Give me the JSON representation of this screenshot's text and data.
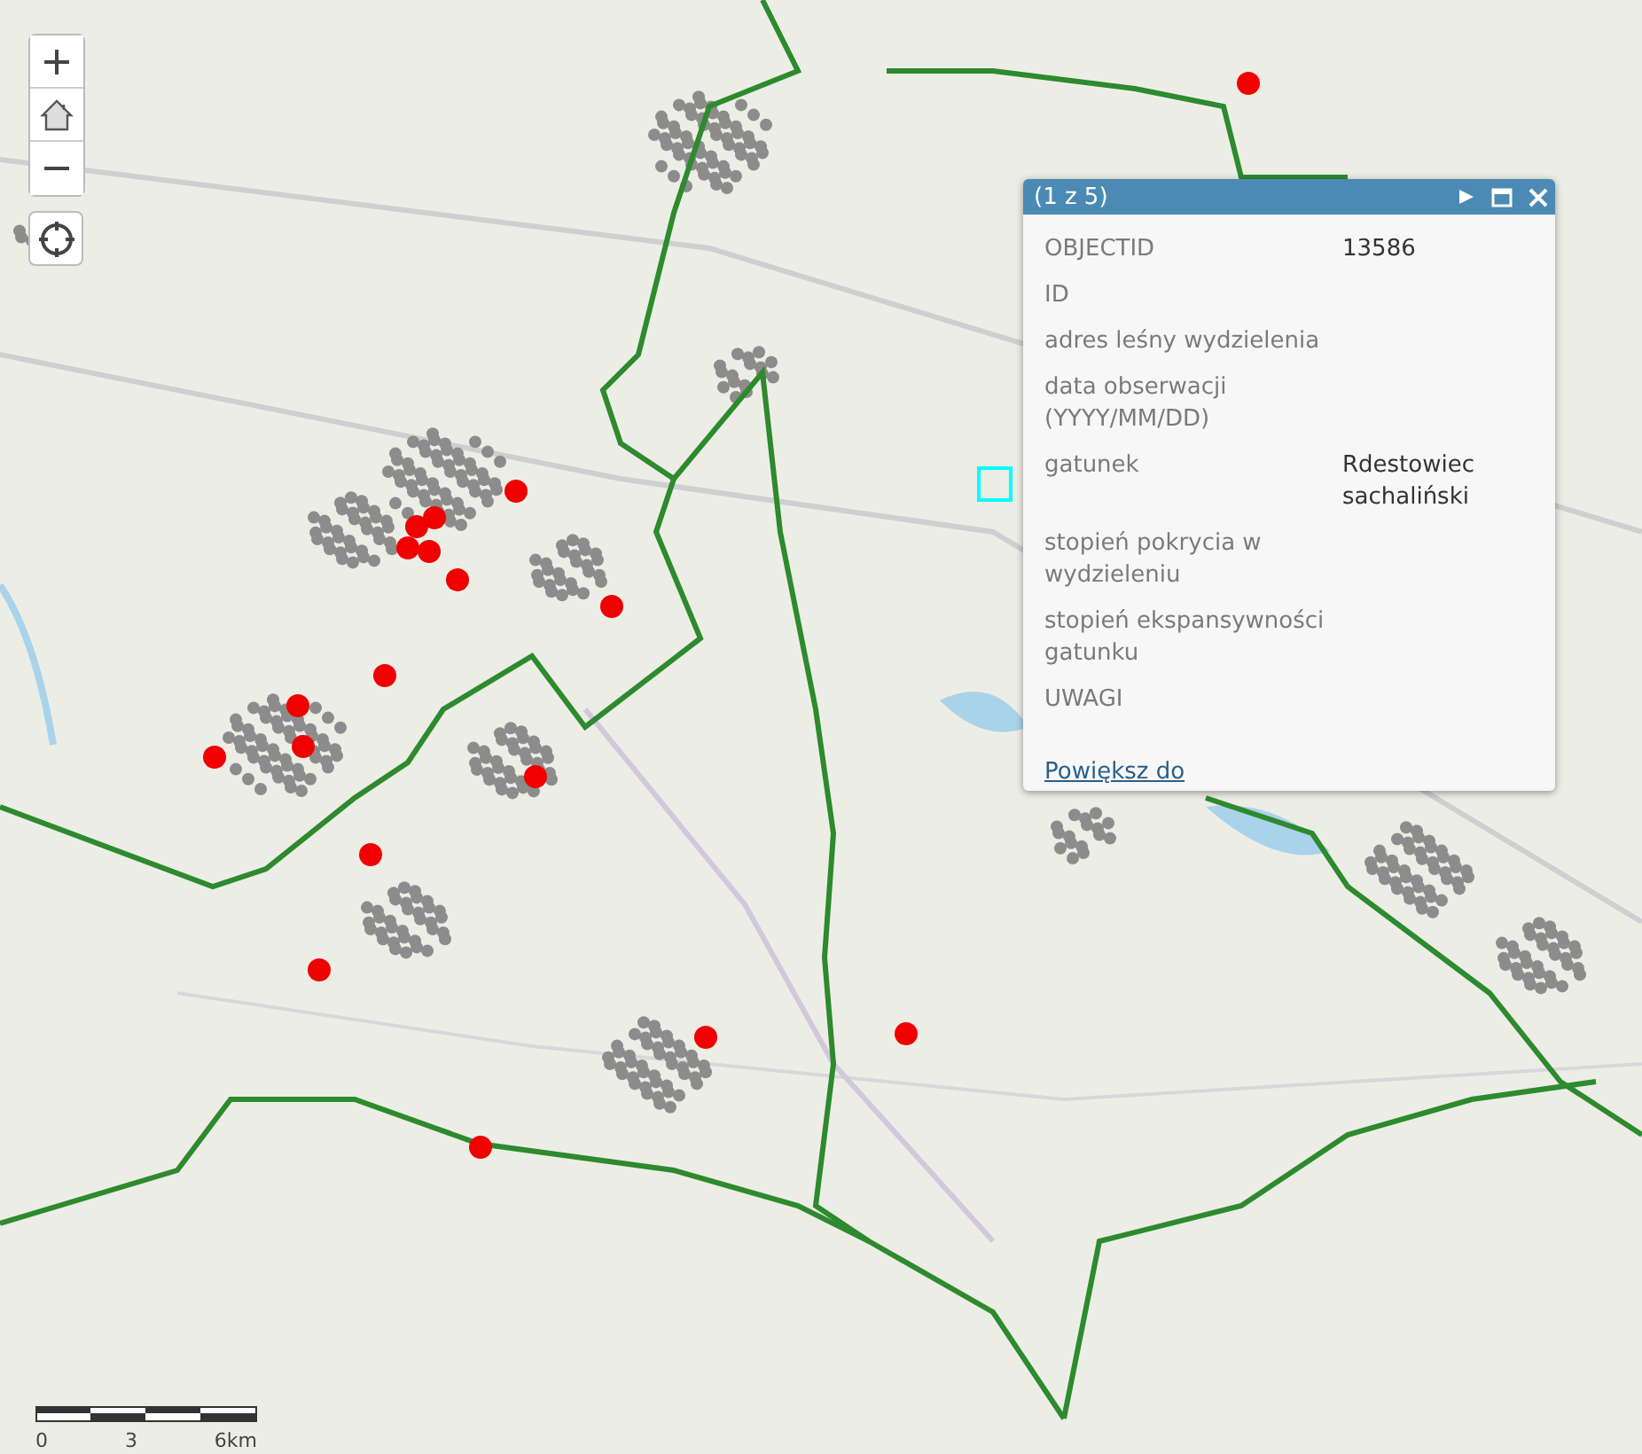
{
  "popup": {
    "title": "(1 z 5)",
    "fields": [
      {
        "label": "OBJECTID",
        "value": "13586"
      },
      {
        "label": "ID"
      },
      {
        "label": "adres leśny wydzielenia"
      },
      {
        "label": "data obserwacji (YYYY/MM/DD)"
      },
      {
        "label": "gatunek",
        "value": "Rdestowiec sachaliński"
      },
      {
        "label": "stopień pokrycia w wydzieleniu"
      },
      {
        "label": "stopień ekspansywności gatunku"
      },
      {
        "label": "UWAGI"
      }
    ],
    "link": "Powiększ do"
  },
  "scale_bar": {
    "labels": [
      "0",
      "3",
      "6km"
    ]
  }
}
